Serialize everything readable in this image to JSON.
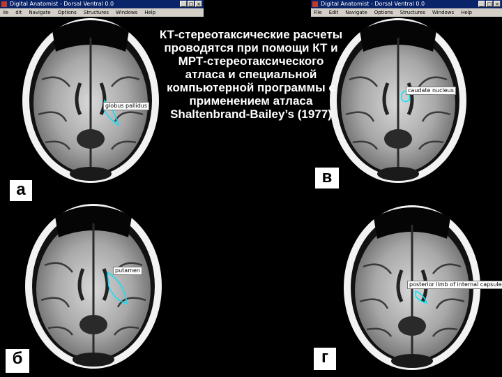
{
  "main_text": "КТ-стереотаксические расчеты проводятся при помощи КТ и МРТ-стереотаксического атласа и специальной компьютерной программы с применением атласа Shaltenbrand-Bailey’s (1977)",
  "letters": {
    "a": "а",
    "b": "б",
    "v": "в",
    "g": "г"
  },
  "windows": {
    "top_left": {
      "title": "Digital Anatomist - Dorsal Ventral 0.0",
      "menu": [
        "ile",
        "dit",
        "Navigate",
        "Options",
        "Structures",
        "Windows",
        "Help"
      ],
      "structure_label": "globus pallidus"
    },
    "top_right": {
      "title": "Digital Anatomist - Dorsal Ventral 0.0",
      "menu": [
        "File",
        "Edit",
        "Navigate",
        "Options",
        "Structures",
        "Windows",
        "Help"
      ],
      "structure_label": "caudate nucleus"
    },
    "bottom_left": {
      "structure_label": "putamen"
    },
    "bottom_right": {
      "structure_label": "posterior limb of internal capsule"
    }
  },
  "colors": {
    "title_bar": "#0a246a",
    "menu_bar": "#d4d0c8",
    "highlight": "#00e5ff"
  }
}
